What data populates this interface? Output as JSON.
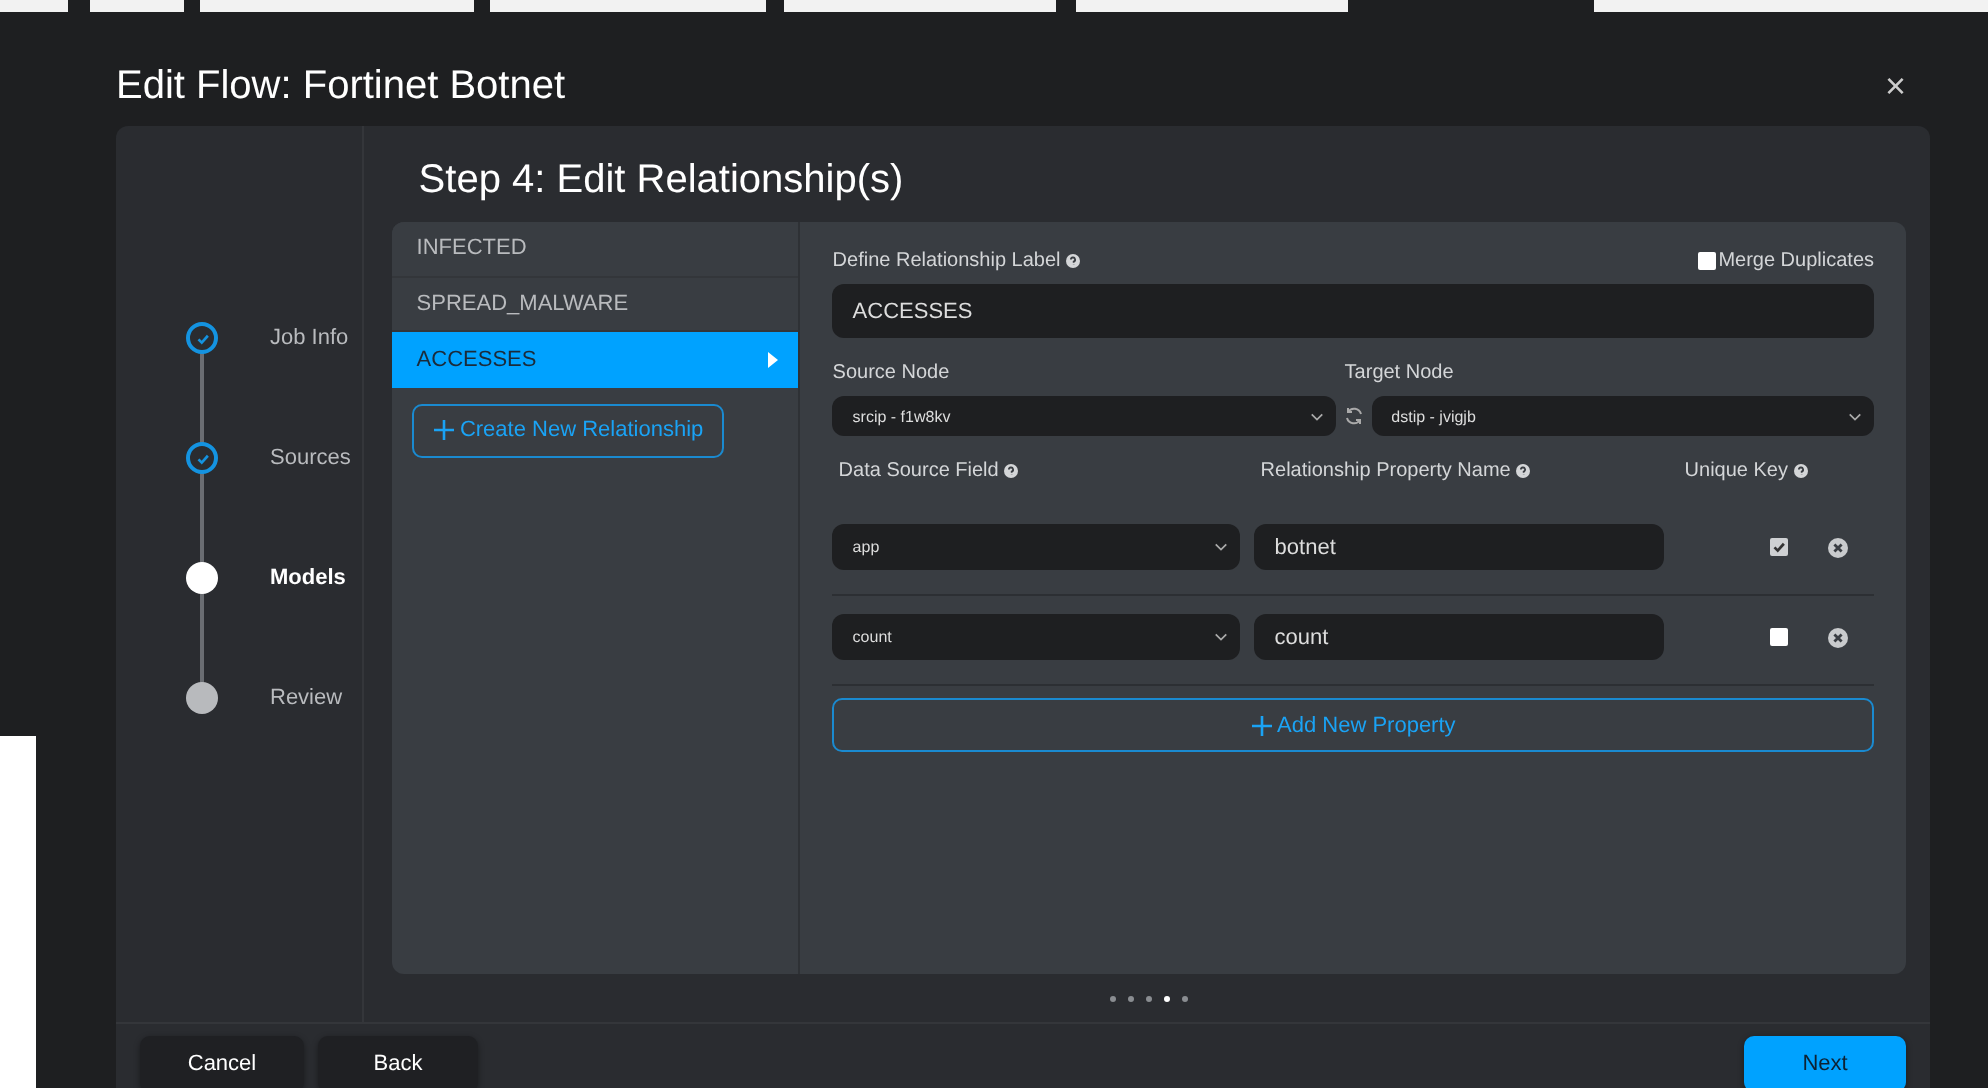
{
  "dialog": {
    "title": "Edit Flow: Fortinet Botnet",
    "close": "×"
  },
  "steps": [
    {
      "label": "Job Info",
      "kind": "done"
    },
    {
      "label": "Sources",
      "kind": "done"
    },
    {
      "label": "Models",
      "kind": "current"
    },
    {
      "label": "Review",
      "kind": "pending"
    }
  ],
  "step_title": "Step 4: Edit Relationship(s)",
  "relationships": [
    {
      "label": "INFECTED",
      "selected": false
    },
    {
      "label": "SPREAD_MALWARE",
      "selected": false
    },
    {
      "label": "ACCESSES",
      "selected": true
    }
  ],
  "create_button": "Create New Relationship",
  "form": {
    "label_title": "Define Relationship Label",
    "merge_duplicates": {
      "label": "Merge Duplicates",
      "checked": false
    },
    "label_value": "ACCESSES",
    "source_node": {
      "label": "Source Node",
      "value": "srcip - f1w8kv"
    },
    "target_node": {
      "label": "Target Node",
      "value": "dstip - jvigjb"
    },
    "columns": [
      "Data Source Field",
      "Relationship Property Name",
      "Unique Key"
    ],
    "properties": [
      {
        "source_field": "app",
        "property_name": "botnet",
        "unique_key": true
      },
      {
        "source_field": "count",
        "property_name": "count",
        "unique_key": false
      }
    ],
    "add_button": "Add New Property"
  },
  "pages": [
    {
      "selected": false
    },
    {
      "selected": false
    },
    {
      "selected": false
    },
    {
      "selected": true
    },
    {
      "selected": false
    }
  ],
  "footer": {
    "cancel": "Cancel",
    "back": "Back",
    "next": "Next"
  }
}
